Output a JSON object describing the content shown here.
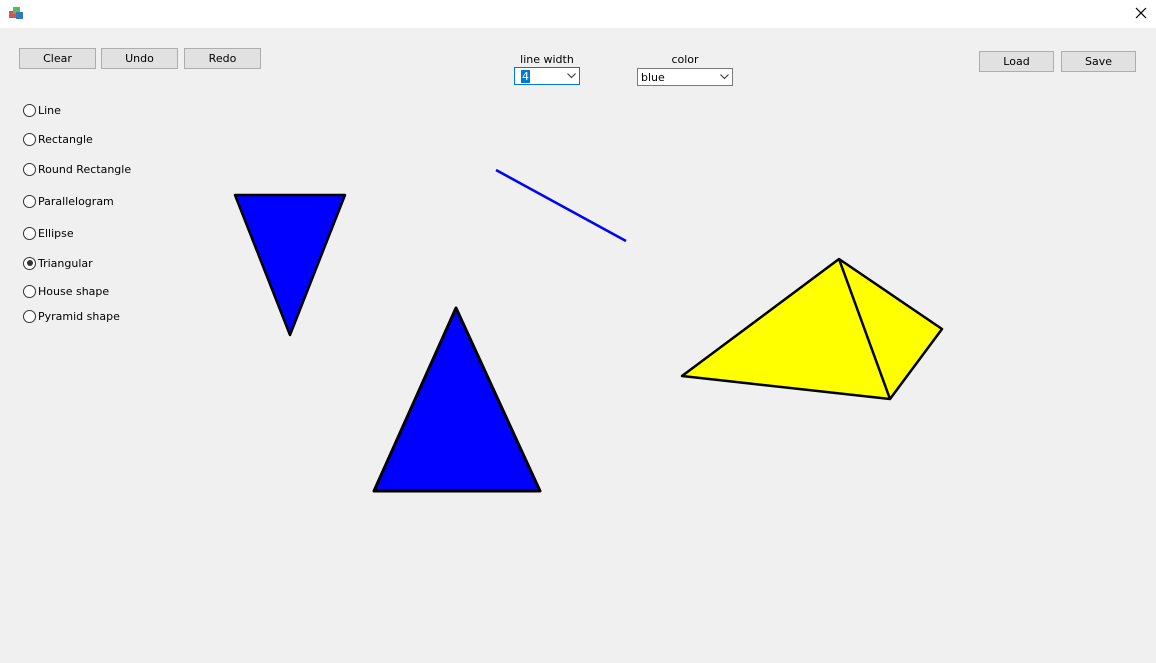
{
  "window": {
    "title": "",
    "app_icon": "app-icon",
    "close_glyph": "✕"
  },
  "toolbar": {
    "clear_label": "Clear",
    "undo_label": "Undo",
    "redo_label": "Redo",
    "load_label": "Load",
    "save_label": "Save"
  },
  "line_width": {
    "label": "line width",
    "value": "4"
  },
  "color": {
    "label": "color",
    "value": "blue"
  },
  "shapes": {
    "items": [
      {
        "label": "Line",
        "checked": false
      },
      {
        "label": "Rectangle",
        "checked": false
      },
      {
        "label": "Round Rectangle",
        "checked": false
      },
      {
        "label": "Parallelogram",
        "checked": false
      },
      {
        "label": "Ellipse",
        "checked": false
      },
      {
        "label": "Triangular",
        "checked": true
      },
      {
        "label": "House shape",
        "checked": false
      },
      {
        "label": "Pyramid shape",
        "checked": false
      }
    ]
  },
  "drawing": {
    "colors": {
      "blue": "#0000ff",
      "yellow": "#ffff00",
      "outline": "#000000"
    },
    "shapes": [
      {
        "kind": "line",
        "color": "blue"
      },
      {
        "kind": "triangle-down",
        "color": "blue"
      },
      {
        "kind": "triangle-up",
        "color": "blue"
      },
      {
        "kind": "pyramid",
        "color": "yellow"
      }
    ]
  }
}
